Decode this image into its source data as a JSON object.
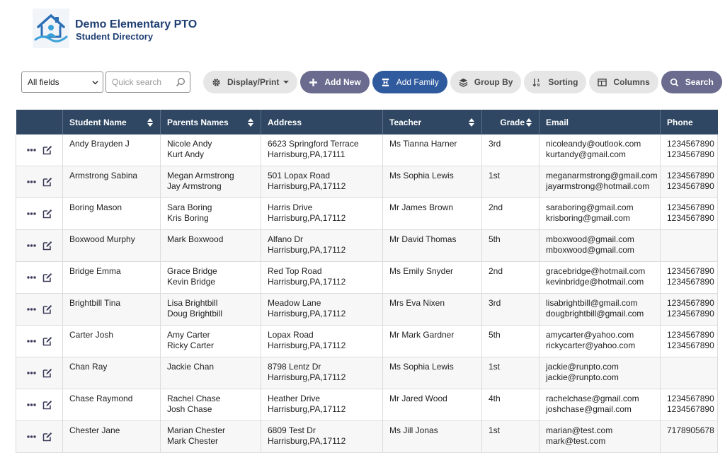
{
  "header": {
    "org_name": "Demo Elementary PTO",
    "page_name": "Student Directory"
  },
  "toolbar": {
    "field_select_value": "All fields",
    "quick_search_placeholder": "Quick search",
    "display_print": "Display/Print",
    "add_new": "Add New",
    "add_family": "Add Family",
    "group_by": "Group By",
    "sorting": "Sorting",
    "columns": "Columns",
    "search": "Search"
  },
  "colors": {
    "header_bg": "#2f4763",
    "primary_blue": "#2f5a9e",
    "slate": "#6b6b8f",
    "title": "#1f3f73"
  },
  "table": {
    "columns": [
      "Student Name",
      "Parents Names",
      "Address",
      "Teacher",
      "Grade",
      "Email",
      "Phone"
    ],
    "rows": [
      {
        "student": "Andy Brayden J",
        "parent1": "Nicole Andy",
        "parent2": "Kurt Andy",
        "addr1": "6623 Springford Terrace",
        "addr2": "Harrisburg,PA,17111",
        "teacher": "Ms Tianna Harner",
        "grade": "3rd",
        "email1": "nicoleandy@outlook.com",
        "email2": "kurtandy@gmail.com",
        "phone1": "1234567890",
        "phone2": "1234567890"
      },
      {
        "student": "Armstrong Sabina",
        "parent1": "Megan Armstrong",
        "parent2": "Jay Armstrong",
        "addr1": "501 Lopax Road",
        "addr2": "Harrisburg,PA,17112",
        "teacher": "Ms Sophia Lewis",
        "grade": "1st",
        "email1": "meganarmstrong@gmail.com",
        "email2": "jayarmstrong@hotmail.com",
        "phone1": "1234567890",
        "phone2": "1234567890"
      },
      {
        "student": "Boring Mason",
        "parent1": "Sara Boring",
        "parent2": "Kris Boring",
        "addr1": "Harris Drive",
        "addr2": "Harrisburg,PA,17112",
        "teacher": "Mr James Brown",
        "grade": "2nd",
        "email1": "saraboring@gmail.com",
        "email2": "krisboring@gmail.com",
        "phone1": "1234567890",
        "phone2": "1234567890"
      },
      {
        "student": "Boxwood Murphy",
        "parent1": "Mark Boxwood",
        "parent2": "",
        "addr1": "Alfano Dr",
        "addr2": "Harrisburg,PA,17112",
        "teacher": "Mr David Thomas",
        "grade": "5th",
        "email1": "mboxwood@gmail.com",
        "email2": "mboxwood@gmail.com",
        "phone1": "",
        "phone2": ""
      },
      {
        "student": "Bridge Emma",
        "parent1": "Grace Bridge",
        "parent2": "Kevin Bridge",
        "addr1": "Red Top Road",
        "addr2": "Harrisburg,PA,17112",
        "teacher": "Ms Emily Snyder",
        "grade": "2nd",
        "email1": "gracebridge@hotmail.com",
        "email2": "kevinbridge@hotmail.com",
        "phone1": "1234567890",
        "phone2": "1234567890"
      },
      {
        "student": "Brightbill Tina",
        "parent1": "Lisa Brightbill",
        "parent2": "Doug Brightbill",
        "addr1": "Meadow Lane",
        "addr2": "Harrisburg,PA,17112",
        "teacher": "Mrs Eva Nixen",
        "grade": "3rd",
        "email1": "lisabrightbill@gmail.com",
        "email2": "dougbrightbill@gmail.com",
        "phone1": "1234567890",
        "phone2": "1234567890"
      },
      {
        "student": "Carter Josh",
        "parent1": "Amy Carter",
        "parent2": "Ricky Carter",
        "addr1": "Lopax Road",
        "addr2": "Harrisburg,PA,17112",
        "teacher": "Mr Mark Gardner",
        "grade": "5th",
        "email1": "amycarter@yahoo.com",
        "email2": "rickycarter@yahoo.com",
        "phone1": "1234567890",
        "phone2": "1234567890"
      },
      {
        "student": "Chan Ray",
        "parent1": "Jackie Chan",
        "parent2": "",
        "addr1": "8798 Lentz Dr",
        "addr2": "Harrisburg,PA,17112",
        "teacher": "Ms Sophia Lewis",
        "grade": "1st",
        "email1": "jackie@runpto.com",
        "email2": "jackie@runpto.com",
        "phone1": "",
        "phone2": ""
      },
      {
        "student": "Chase Raymond",
        "parent1": "Rachel Chase",
        "parent2": "Josh Chase",
        "addr1": "Heather Drive",
        "addr2": "Harrisburg,PA,17112",
        "teacher": "Mr Jared Wood",
        "grade": "4th",
        "email1": "rachelchase@gmail.com",
        "email2": "joshchase@gmail.com",
        "phone1": "1234567890",
        "phone2": "1234567890"
      },
      {
        "student": "Chester Jane",
        "parent1": "Marian Chester",
        "parent2": "Mark Chester",
        "addr1": "6809 Test Dr",
        "addr2": "Harrisburg,PA,17112",
        "teacher": "Ms Jill Jonas",
        "grade": "1st",
        "email1": "marian@test.com",
        "email2": "mark@test.com",
        "phone1": "7178905678",
        "phone2": ""
      }
    ]
  }
}
